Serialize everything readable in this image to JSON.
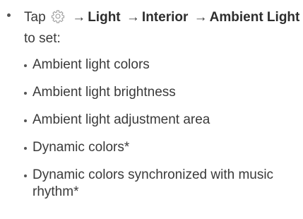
{
  "instruction": {
    "prefix": "Tap",
    "arrow": "→",
    "step1": "Light",
    "step2": "Interior",
    "step3": "Ambient Light",
    "suffix": "to set:"
  },
  "icons": {
    "settings": "gear-icon"
  },
  "items": [
    "Ambient light colors",
    "Ambient light brightness",
    "Ambient light adjustment area",
    "Dynamic colors*",
    "Dynamic colors synchronized with music rhythm*"
  ]
}
